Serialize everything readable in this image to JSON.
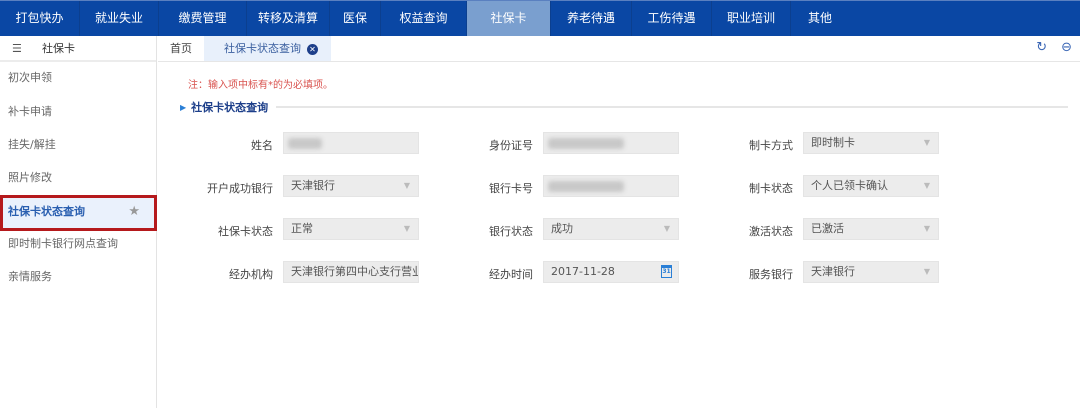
{
  "nav": [
    "打包快办",
    "就业失业",
    "缴费管理",
    "转移及清算",
    "医保",
    "权益查询",
    "社保卡",
    "养老待遇",
    "工伤待遇",
    "职业培训",
    "其他"
  ],
  "sidebar": {
    "title": "社保卡",
    "items": [
      "初次申领",
      "补卡申请",
      "挂失/解挂",
      "照片修改",
      "社保卡状态查询",
      "即时制卡银行网点查询",
      "亲情服务"
    ]
  },
  "tabs": {
    "home": "首页",
    "current": "社保卡状态查询"
  },
  "note": "注：输入项中标有*的为必填项。",
  "section_title": "社保卡状态查询",
  "fields": {
    "name_label": "姓名",
    "id_label": "身份证号",
    "method_label": "制卡方式",
    "method": "即时制卡",
    "bank_label": "开户成功银行",
    "bank": "天津银行",
    "card_label": "银行卡号",
    "card_status_label": "制卡状态",
    "card_status": "个人已领卡确认",
    "sscard_status_label": "社保卡状态",
    "sscard_status": "正常",
    "bank_status_label": "银行状态",
    "bank_status": "成功",
    "activate_label": "激活状态",
    "activate": "已激活",
    "agency_label": "经办机构",
    "agency": "天津银行第四中心支行营业部",
    "time_label": "经办时间",
    "time": "2017-11-28",
    "service_bank_label": "服务银行",
    "service_bank": "天津银行"
  }
}
